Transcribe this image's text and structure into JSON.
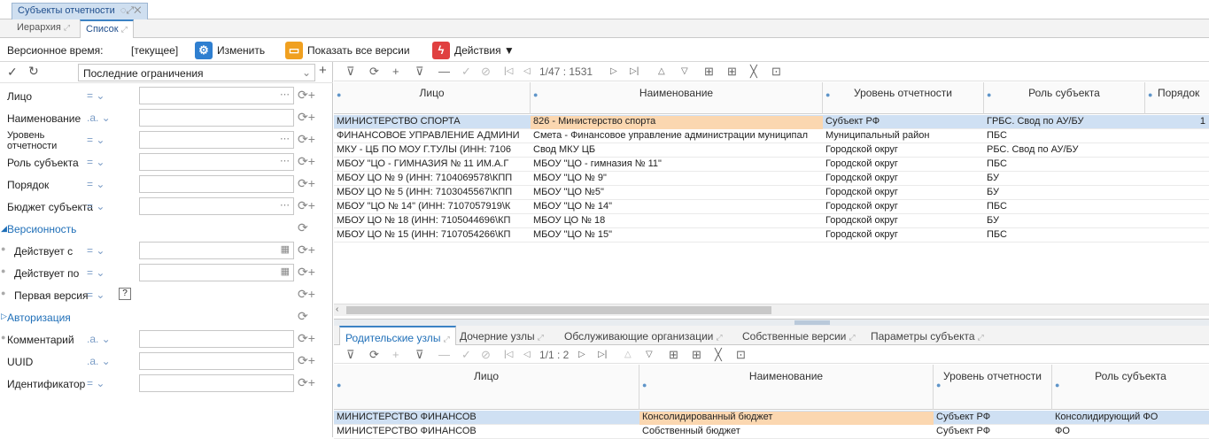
{
  "window": {
    "title": "Субъекты отчетности",
    "title_icons": "◌⤢✕"
  },
  "subtabs": [
    {
      "label": "Иерархия"
    },
    {
      "label": "Список"
    }
  ],
  "toolbar": {
    "version_label": "Версионное время:",
    "version_value": "[текущее]",
    "change_label": "Изменить",
    "show_versions_label": "Показать все версии",
    "actions_label": "Действия ▼"
  },
  "filters": {
    "preset": "Последние ограничения",
    "rows": [
      {
        "label": "Лицо",
        "op": "= ⌄"
      },
      {
        "label": "Наименование",
        "op": ".a. ⌄"
      },
      {
        "label": "Уровень отчетности",
        "op": "= ⌄"
      },
      {
        "label": "Роль субъекта",
        "op": "= ⌄"
      },
      {
        "label": "Порядок",
        "op": "= ⌄"
      },
      {
        "label": "Бюджет субъекта",
        "op": "= ⌄"
      }
    ],
    "group_versions": "Версионность",
    "version_rows": [
      {
        "label": "Действует с",
        "op": "= ⌄"
      },
      {
        "label": "Действует по",
        "op": "= ⌄"
      },
      {
        "label": "Первая версия",
        "op": "= ⌄",
        "value": "?"
      }
    ],
    "group_auth": "Авторизация",
    "auth_rows": [
      {
        "label": "Комментарий",
        "op": ".a. ⌄"
      },
      {
        "label": "UUID",
        "op": ".a. ⌄"
      },
      {
        "label": "Идентификатор",
        "op": "= ⌄"
      }
    ]
  },
  "grid": {
    "pager": "1/47 : 1531",
    "columns": [
      "Лицо",
      "Наименование",
      "Уровень отчетности",
      "Роль субъекта",
      "Порядок"
    ],
    "rows": [
      [
        "МИНИСТЕРСТВО СПОРТА",
        "826 - Министерство спорта",
        "Субъект РФ",
        "ГРБС. Свод по АУ/БУ",
        "1"
      ],
      [
        "ФИНАНСОВОЕ УПРАВЛЕНИЕ АДМИНИ",
        "Смета - Финансовое управление администрации муниципал",
        "Муниципальный район",
        "ПБС",
        ""
      ],
      [
        "МКУ - ЦБ ПО МОУ Г.ТУЛЫ (ИНН: 7106",
        "Свод МКУ ЦБ",
        "Городской округ",
        "РБС. Свод по АУ/БУ",
        ""
      ],
      [
        "МБОУ \"ЦО - ГИМНАЗИЯ № 11 ИМ.А.Г",
        "МБОУ \"ЦО - гимназия № 11\"",
        "Городской округ",
        "ПБС",
        ""
      ],
      [
        "МБОУ ЦО № 9 (ИНН: 7104069578\\КПП",
        "МБОУ \"ЦО № 9\"",
        "Городской округ",
        "БУ",
        ""
      ],
      [
        "МБОУ ЦО № 5 (ИНН: 7103045567\\КПП",
        "МБОУ \"ЦО №5\"",
        "Городской округ",
        "БУ",
        ""
      ],
      [
        "МБОУ \"ЦО № 14\" (ИНН: 7107057919\\К",
        "МБОУ \"ЦО № 14\"",
        "Городской округ",
        "ПБС",
        ""
      ],
      [
        "МБОУ ЦО № 18 (ИНН: 7105044696\\КП",
        "МБОУ ЦО № 18",
        "Городской округ",
        "БУ",
        ""
      ],
      [
        "МБОУ ЦО № 15 (ИНН: 7107054266\\КП",
        "МБОУ \"ЦО № 15\"",
        "Городской округ",
        "ПБС",
        ""
      ]
    ]
  },
  "bottom": {
    "tabs": [
      "Родительские узлы",
      "Дочерние узлы",
      "Обслуживающие организации",
      "Собственные версии",
      "Параметры субъекта"
    ],
    "pager": "1/1 : 2",
    "columns": [
      "Лицо",
      "Наименование",
      "Уровень отчетности",
      "Роль субъекта"
    ],
    "rows": [
      [
        "МИНИСТЕРСТВО ФИНАНСОВ",
        "Консолидированный бюджет",
        "Субъект РФ",
        "Консолидирующий ФО"
      ],
      [
        "МИНИСТЕРСТВО ФИНАНСОВ",
        "Собственный бюджет",
        "Субъект РФ",
        "ФО"
      ]
    ]
  },
  "colors": {
    "accent": "#3b82c4",
    "selected_row": "#cfe0f3",
    "selected_cell": "#fbd7b0"
  }
}
